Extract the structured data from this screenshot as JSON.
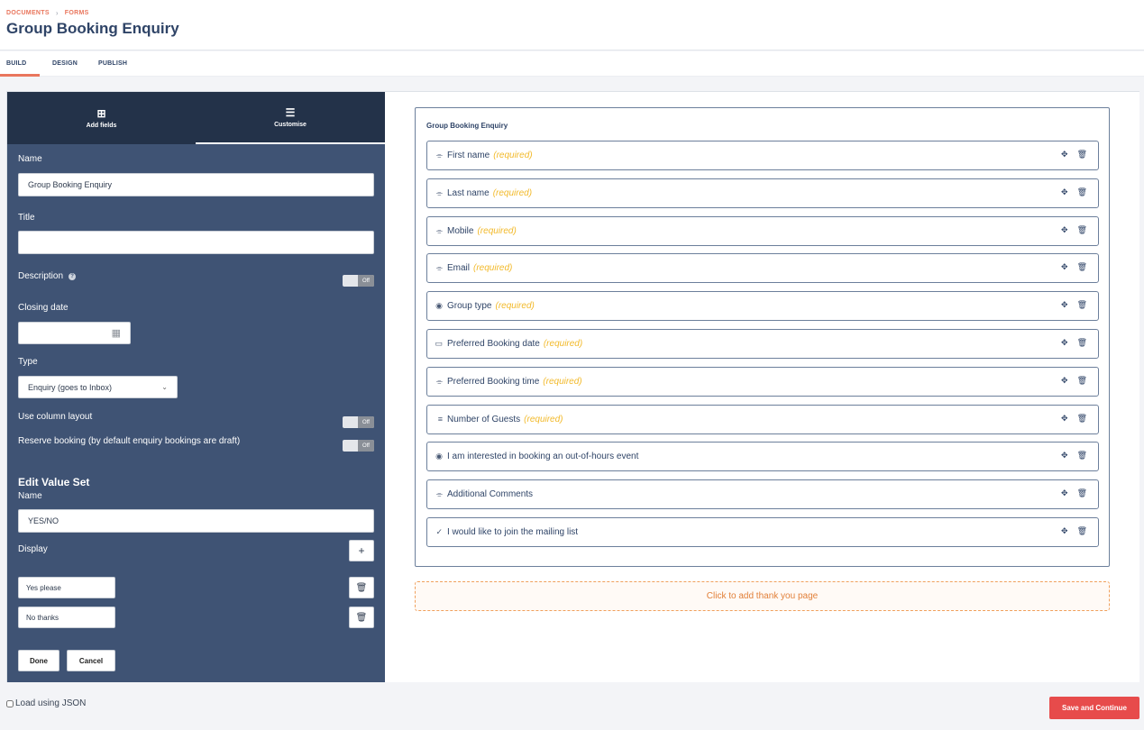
{
  "breadcrumb": [
    "DOCUMENTS",
    "FORMS"
  ],
  "page_title": "Group Booking Enquiry",
  "tabs": [
    "BUILD",
    "DESIGN",
    "PUBLISH"
  ],
  "panel_tabs": {
    "add_fields": "Add fields",
    "customise": "Customise"
  },
  "settings": {
    "name_label": "Name",
    "name_value": "Group Booking Enquiry",
    "title_label": "Title",
    "title_value": "",
    "description_label": "Description",
    "description_toggle": "Off",
    "closing_date_label": "Closing date",
    "type_label": "Type",
    "type_value": "Enquiry (goes to Inbox)",
    "column_layout_label": "Use column layout",
    "column_layout_toggle": "Off",
    "reserve_label": "Reserve booking (by default enquiry bookings are draft)",
    "reserve_toggle": "Off"
  },
  "value_set": {
    "heading": "Edit Value Set",
    "name_label": "Name",
    "name_value": "YES/NO",
    "display_label": "Display",
    "options": [
      "Yes please",
      "No thanks"
    ],
    "done": "Done",
    "cancel": "Cancel"
  },
  "form": {
    "title": "Group Booking Enquiry",
    "fields": [
      {
        "label": "First name",
        "required": "(required)",
        "icon": "text-icon"
      },
      {
        "label": "Last name",
        "required": "(required)",
        "icon": "text-icon"
      },
      {
        "label": "Mobile",
        "required": "(required)",
        "icon": "text-icon"
      },
      {
        "label": "Email",
        "required": "(required)",
        "icon": "text-icon"
      },
      {
        "label": "Group type",
        "required": "(required)",
        "icon": "radio-icon"
      },
      {
        "label": "Preferred Booking date",
        "required": "(required)",
        "icon": "calendar-icon"
      },
      {
        "label": "Preferred Booking time",
        "required": "(required)",
        "icon": "text-icon"
      },
      {
        "label": "Number of Guests",
        "required": "(required)",
        "icon": "list-icon"
      },
      {
        "label": "I am interested in booking an out-of-hours event",
        "required": "",
        "icon": "radio-icon"
      },
      {
        "label": "Additional Comments",
        "required": "",
        "icon": "text-icon"
      },
      {
        "label": "I would like to join the mailing list",
        "required": "",
        "icon": "check-icon"
      }
    ],
    "thank_you": "Click to add thank you page"
  },
  "footer": {
    "load_json": "Load using JSON",
    "save": "Save and Continue"
  }
}
